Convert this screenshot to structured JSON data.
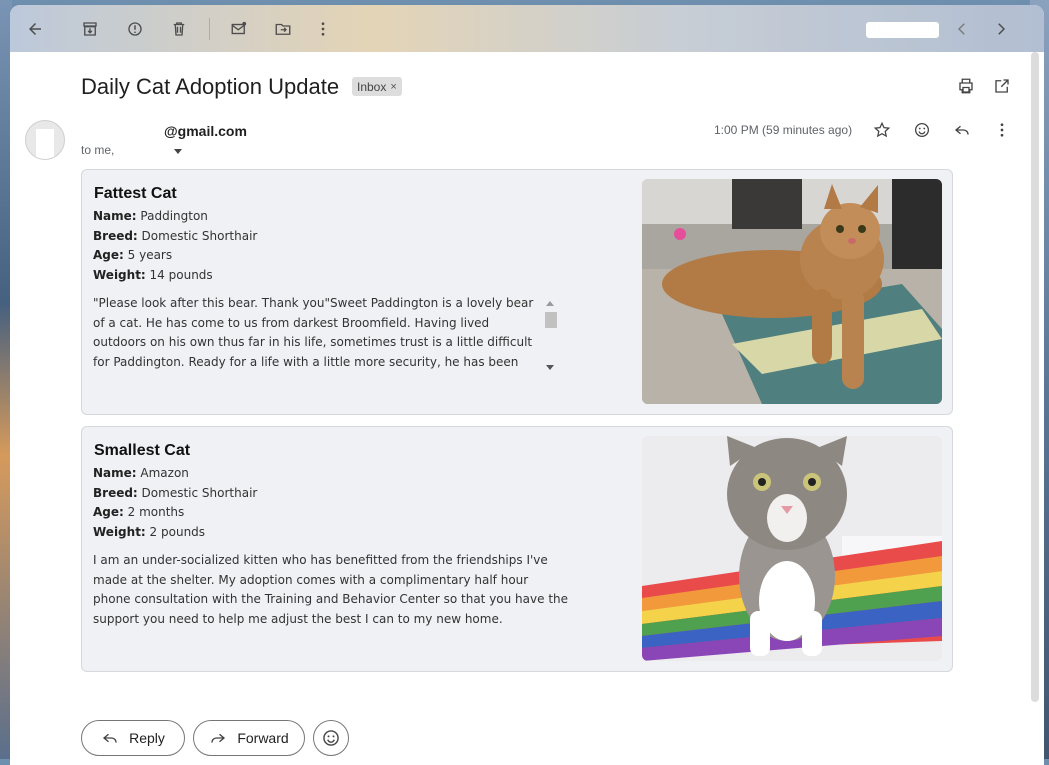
{
  "email": {
    "subject": "Daily Cat Adoption Update",
    "label_chip": "Inbox",
    "label_chip_remove": "×",
    "sender": "@gmail.com",
    "recipient_line": "to me,",
    "timestamp": "1:00 PM (59 minutes ago)"
  },
  "cards": [
    {
      "heading": "Fattest Cat",
      "name_label": "Name:",
      "name": " Paddington",
      "breed_label": "Breed:",
      "breed": " Domestic Shorthair",
      "age_label": "Age:",
      "age": " 5 years",
      "weight_label": "Weight:",
      "weight": " 14 pounds",
      "description": "\"Please look after this bear. Thank you\"Sweet Paddington is a lovely bear of a cat. He has come to us from darkest Broomfield. Having lived outdoors on his own thus far in his life, sometimes trust is a little difficult for Paddington. Ready for a life with a little more security, he has been working with the staff"
    },
    {
      "heading": "Smallest Cat",
      "name_label": "Name:",
      "name": " Amazon",
      "breed_label": "Breed:",
      "breed": " Domestic Shorthair",
      "age_label": "Age:",
      "age": " 2 months",
      "weight_label": "Weight:",
      "weight": " 2 pounds",
      "description": "I am an under-socialized kitten who has benefitted from the friendships I've made at the shelter. My adoption comes with a complimentary half hour phone consultation with the Training and Behavior Center so that you have the support you need to help me adjust the best I can to my new home."
    }
  ],
  "actions": {
    "reply_label": "Reply",
    "forward_label": "Forward"
  },
  "icons": {
    "toolbar": [
      "back-arrow-icon",
      "archive-icon",
      "report-spam-icon",
      "delete-icon",
      "mark-unread-icon",
      "move-to-icon",
      "more-vert-icon",
      "newer-icon",
      "older-icon"
    ],
    "header": [
      "print-icon",
      "open-in-new-window-icon",
      "star-icon",
      "emoji-reaction-icon",
      "reply-icon",
      "more-vert-icon"
    ]
  },
  "colors": {
    "card_bg": "#f0f1f5",
    "chip_bg": "#dddddd",
    "text_primary": "#1f1f1f",
    "text_secondary": "#5f6368"
  }
}
